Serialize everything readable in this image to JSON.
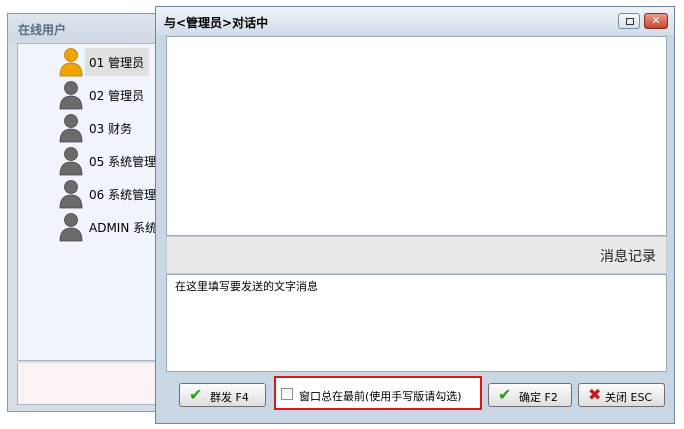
{
  "online_users_window": {
    "title": "在线用户",
    "users": [
      {
        "name": "01 管理员",
        "status": "online",
        "selected": true
      },
      {
        "name": "02 管理员",
        "status": "offline",
        "selected": false
      },
      {
        "name": "03 财务",
        "status": "offline",
        "selected": false
      },
      {
        "name": "05 系统管理",
        "status": "offline",
        "selected": false
      },
      {
        "name": "06 系统管理",
        "status": "offline",
        "selected": false
      },
      {
        "name": "ADMIN 系统",
        "status": "offline",
        "selected": false
      }
    ]
  },
  "chat_dialog": {
    "title": "与<管理员>对话中",
    "titlebar_buttons": {
      "restore_icon": "restore-icon",
      "close_icon": "close-icon"
    },
    "history_label": "消息记录",
    "message_input": {
      "value": "在这里填写要发送的文字消息"
    },
    "buttons": {
      "broadcast": {
        "label": "群发 F4",
        "icon": "green-check-icon"
      },
      "confirm": {
        "label": "确定 F2",
        "icon": "green-check-icon"
      },
      "close": {
        "label": "关闭 ESC",
        "icon": "red-x-icon"
      }
    },
    "always_on_top": {
      "label": "窗口总在最前(使用手写版请勾选)",
      "checked": false
    }
  },
  "colors": {
    "online_avatar": "#f0a400",
    "offline_avatar": "#6b6b6b",
    "highlight_border": "#e0141b",
    "check_green": "#2c9a1c",
    "close_red": "#c41a1a"
  }
}
